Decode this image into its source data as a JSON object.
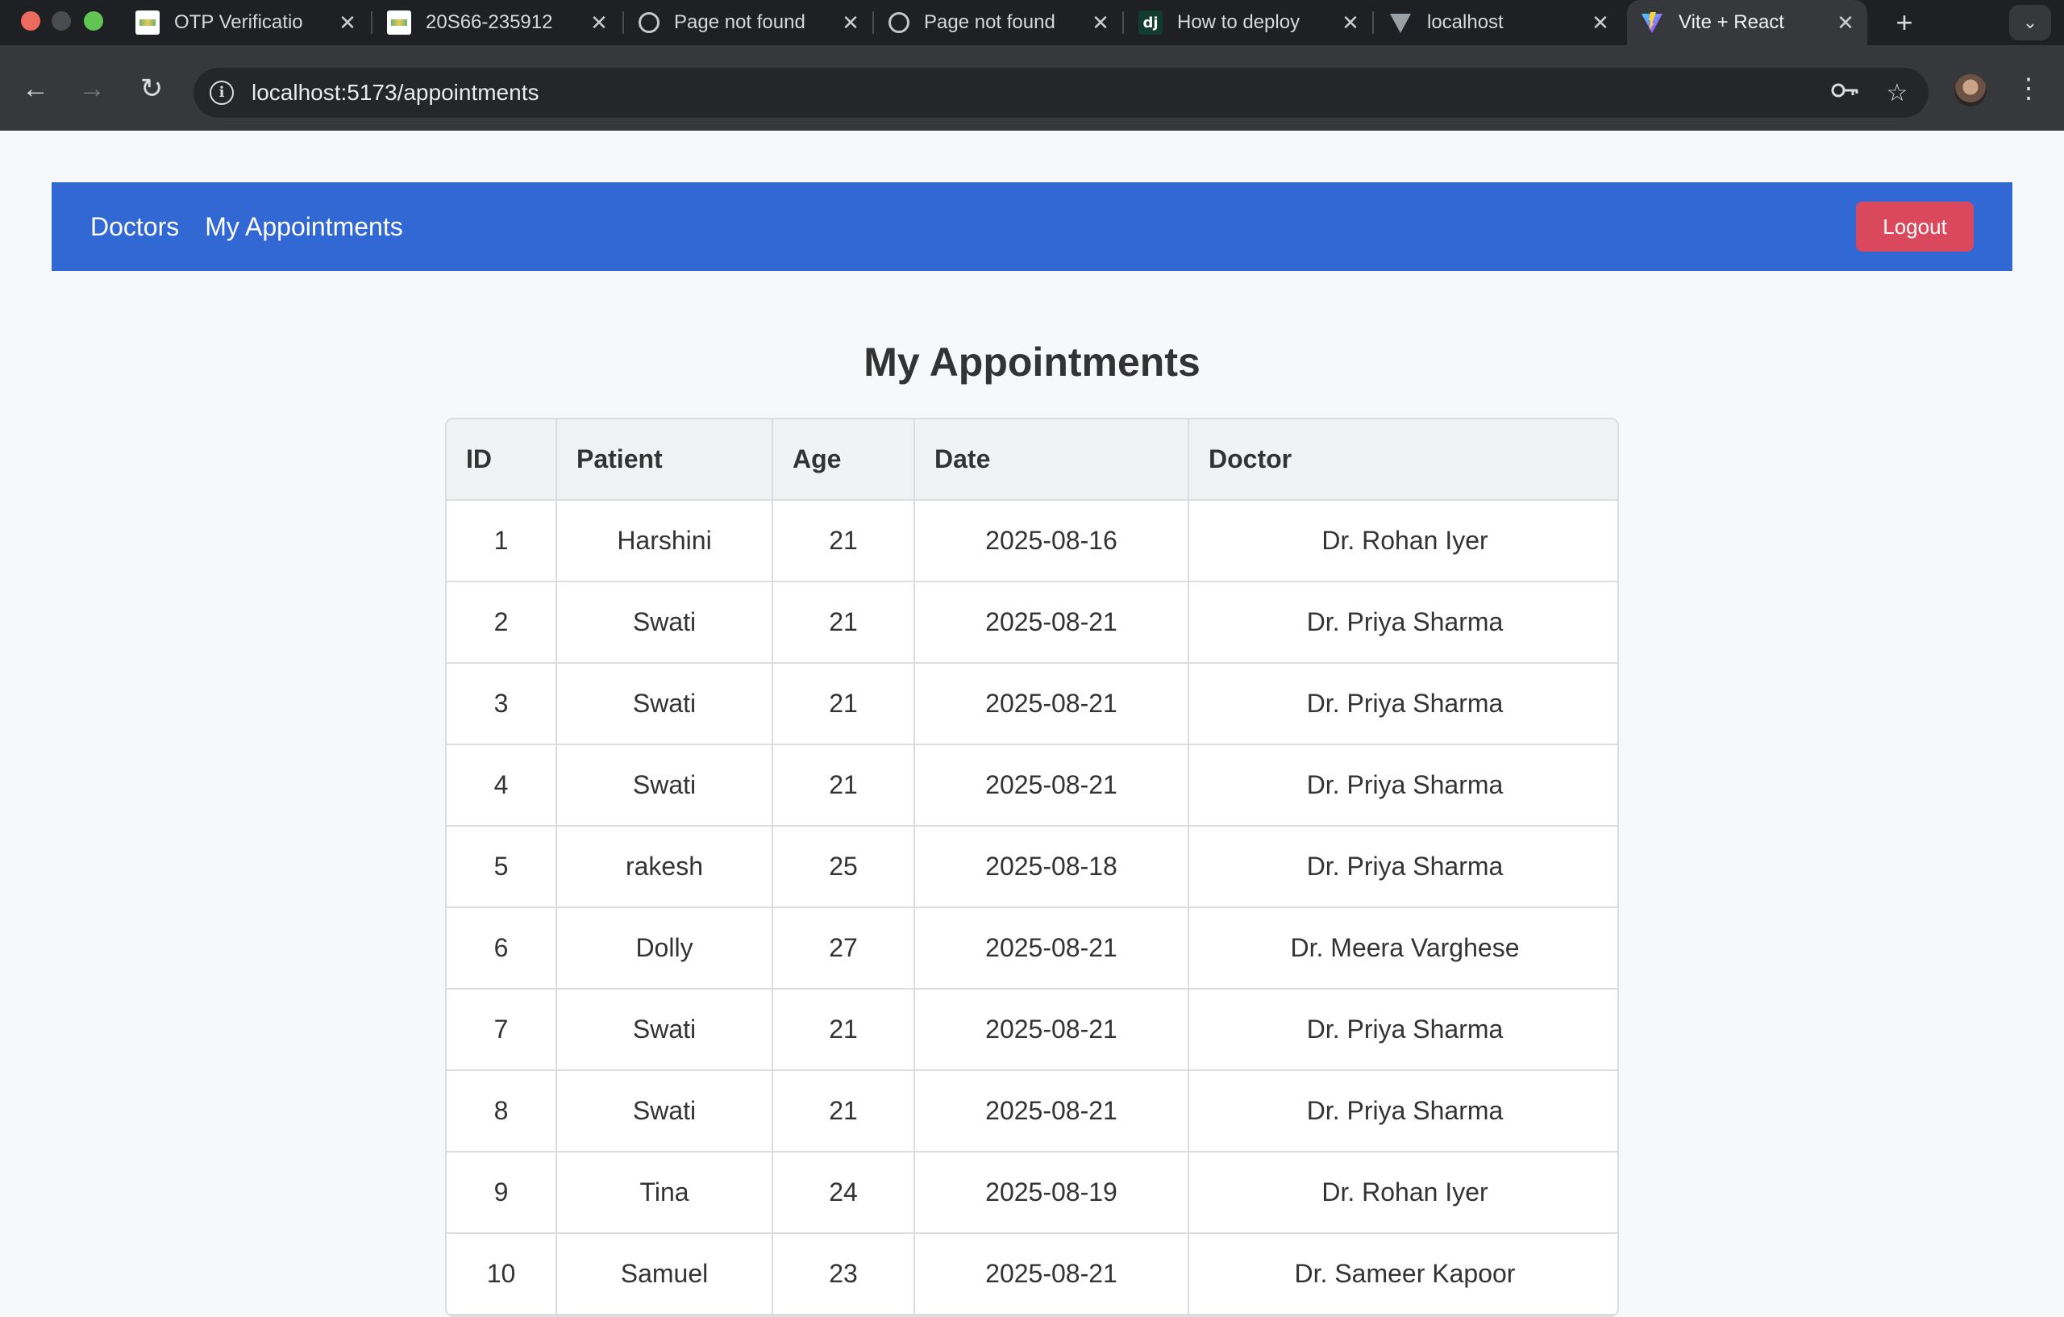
{
  "browser": {
    "tabs": [
      {
        "title": "OTP Verificatio",
        "favicon": "image-favicon"
      },
      {
        "title": "20S66-235912",
        "favicon": "image-favicon"
      },
      {
        "title": "Page not found",
        "favicon": "globe-icon"
      },
      {
        "title": "Page not found",
        "favicon": "globe-icon"
      },
      {
        "title": "How to deploy",
        "favicon": "django-icon",
        "favicon_text": "dj"
      },
      {
        "title": "localhost",
        "favicon": "vite-icon"
      },
      {
        "title": "Vite + React",
        "favicon": "vite-icon",
        "active": true
      }
    ],
    "url": "localhost:5173/appointments"
  },
  "navbar": {
    "links": [
      "Doctors",
      "My Appointments"
    ],
    "logout_label": "Logout",
    "color": "#3268d3",
    "logout_color": "#d9485c"
  },
  "main": {
    "title": "My Appointments",
    "table": {
      "headers": [
        "ID",
        "Patient",
        "Age",
        "Date",
        "Doctor"
      ],
      "rows": [
        [
          "1",
          "Harshini",
          "21",
          "2025-08-16",
          "Dr. Rohan Iyer"
        ],
        [
          "2",
          "Swati",
          "21",
          "2025-08-21",
          "Dr. Priya Sharma"
        ],
        [
          "3",
          "Swati",
          "21",
          "2025-08-21",
          "Dr. Priya Sharma"
        ],
        [
          "4",
          "Swati",
          "21",
          "2025-08-21",
          "Dr. Priya Sharma"
        ],
        [
          "5",
          "rakesh",
          "25",
          "2025-08-18",
          "Dr. Priya Sharma"
        ],
        [
          "6",
          "Dolly",
          "27",
          "2025-08-21",
          "Dr. Meera Varghese"
        ],
        [
          "7",
          "Swati",
          "21",
          "2025-08-21",
          "Dr. Priya Sharma"
        ],
        [
          "8",
          "Swati",
          "21",
          "2025-08-21",
          "Dr. Priya Sharma"
        ],
        [
          "9",
          "Tina",
          "24",
          "2025-08-19",
          "Dr. Rohan Iyer"
        ],
        [
          "10",
          "Samuel",
          "23",
          "2025-08-21",
          "Dr. Sameer Kapoor"
        ]
      ]
    }
  }
}
